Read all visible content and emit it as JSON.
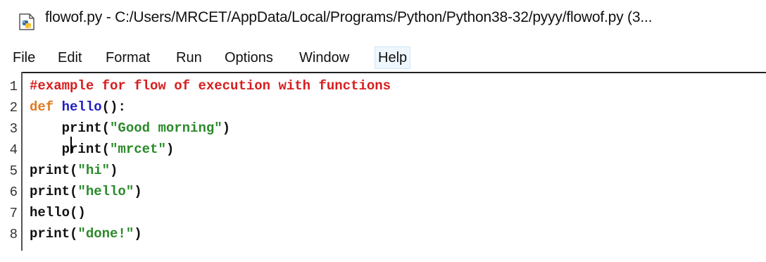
{
  "window": {
    "title": "flowof.py - C:/Users/MRCET/AppData/Local/Programs/Python/Python38-32/pyyy/flowof.py (3..."
  },
  "menu": [
    "File",
    "Edit",
    "Format",
    "Run",
    "Options",
    "Window",
    "Help"
  ],
  "editor": {
    "line_numbers": [
      "1",
      "2",
      "3",
      "4",
      "5",
      "6",
      "7",
      "8"
    ],
    "lines": [
      "#example for flow of execution with functions",
      "def hello():",
      "    print(\"Good morning\")",
      "    print(\"mrcet\")",
      "print(\"hi\")",
      "print(\"hello\")",
      "hello()",
      "print(\"done!\")"
    ]
  },
  "colors": {
    "comment": "#d71d1d",
    "keyword": "#e07a1f",
    "function_name": "#1f1fbf",
    "string": "#2a8a2a"
  },
  "icons": {
    "app": "python-file-icon"
  }
}
